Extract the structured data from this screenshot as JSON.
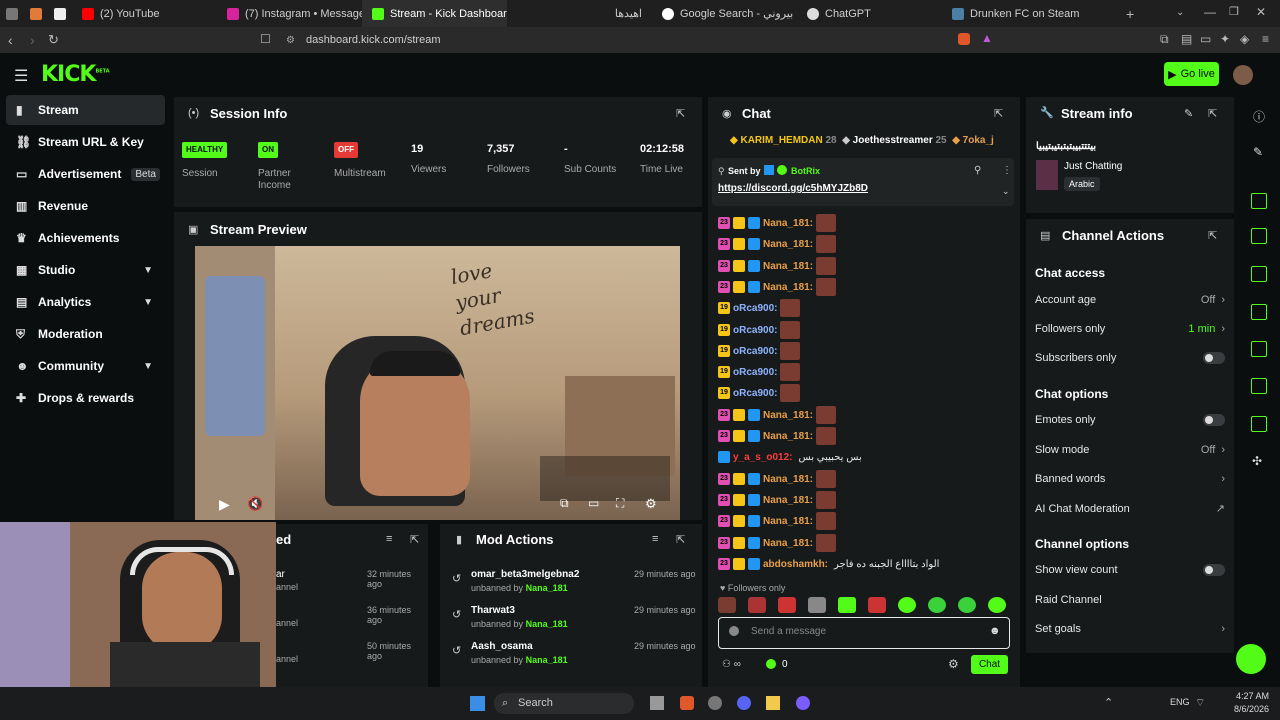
{
  "browser": {
    "tabs": [
      {
        "label": "",
        "color": "#888"
      },
      {
        "label": "",
        "color": "#e07b39"
      },
      {
        "label": "",
        "color": "#eee"
      },
      {
        "label": "(2) YouTube",
        "color": "#ff0000"
      },
      {
        "label": "(7) Instagram • Messages",
        "color": "#d6249f"
      },
      {
        "label": "Stream - Kick Dashboard",
        "color": "#53fc18"
      },
      {
        "label": "اهيدها",
        "color": "#888"
      },
      {
        "label": "Google Search - بيتزا بيروني",
        "color": "#4285f4"
      },
      {
        "label": "ChatGPT",
        "color": "#ddd"
      },
      {
        "label": "Drunken FC on Steam",
        "color": "#2a475e"
      }
    ],
    "url": "dashboard.kick.com/stream"
  },
  "header": {
    "logo": "KICK",
    "logo_sup": "BETA",
    "go_live": "Go live"
  },
  "sidebar": {
    "items": [
      {
        "label": "Stream",
        "icon": "broadcast-icon"
      },
      {
        "label": "Stream URL & Key",
        "icon": "link-icon"
      },
      {
        "label": "Advertisement",
        "icon": "ad-icon",
        "badge": "Beta"
      },
      {
        "label": "Revenue",
        "icon": "revenue-icon"
      },
      {
        "label": "Achievements",
        "icon": "trophy-icon"
      },
      {
        "label": "Studio",
        "icon": "studio-icon",
        "chevron": true
      },
      {
        "label": "Analytics",
        "icon": "analytics-icon",
        "chevron": true
      },
      {
        "label": "Moderation",
        "icon": "shield-icon"
      },
      {
        "label": "Community",
        "icon": "people-icon",
        "chevron": true
      },
      {
        "label": "Drops & rewards",
        "icon": "gift-icon"
      }
    ]
  },
  "session": {
    "title": "Session Info",
    "stats": [
      {
        "badge": "HEALTHY",
        "label": "Session",
        "badge_bg": "#53fc18",
        "badge_fg": "#0b0e0f"
      },
      {
        "badge": "ON",
        "label": "Partner Income",
        "badge_bg": "#53fc18",
        "badge_fg": "#0b0e0f"
      },
      {
        "badge": "OFF",
        "label": "Multistream",
        "badge_bg": "#e53935",
        "badge_fg": "#ffffff"
      },
      {
        "value": "19",
        "label": "Viewers"
      },
      {
        "value": "7,357",
        "label": "Followers"
      },
      {
        "value": "-",
        "label": "Sub Counts"
      },
      {
        "value": "02:12:58",
        "label": "Time Live"
      }
    ]
  },
  "preview": {
    "title": "Stream Preview",
    "wall_text": "love your dreams"
  },
  "partial_panel": {
    "title_fragment": "ed",
    "rows": [
      {
        "name": "ar",
        "sub": "annel",
        "time": "32 minutes ago"
      },
      {
        "name": "",
        "sub": "annel",
        "time": "36 minutes ago"
      },
      {
        "name": "",
        "sub": "annel",
        "time": "50 minutes ago"
      }
    ]
  },
  "mod_actions": {
    "title": "Mod Actions",
    "rows": [
      {
        "user": "omar_beta3melgebna2",
        "action": "unbanned by",
        "by": "Nana_181",
        "time": "29 minutes ago"
      },
      {
        "user": "Tharwat3",
        "action": "unbanned by",
        "by": "Nana_181",
        "time": "29 minutes ago"
      },
      {
        "user": "Aash_osama",
        "action": "unbanned by",
        "by": "Nana_181",
        "time": "29 minutes ago"
      }
    ]
  },
  "chat": {
    "title": "Chat",
    "top_gifters": [
      {
        "name": "KARIM_HEMDAN",
        "count": "28"
      },
      {
        "name": "Joethesstreamer",
        "count": "25"
      },
      {
        "name": "7oka_j",
        "count": ""
      }
    ],
    "pinned": {
      "sent_by_label": "Sent by",
      "sender": "BotRix",
      "link": "https://discord.gg/c5hMYJZb8D"
    },
    "messages": [
      {
        "badge_num": "23",
        "badge_color": "#e24fb2",
        "user": "Nana_181:",
        "color": "#e8a04a"
      },
      {
        "badge_num": "23",
        "badge_color": "#e24fb2",
        "user": "Nana_181:",
        "color": "#e8a04a"
      },
      {
        "badge_num": "23",
        "badge_color": "#e24fb2",
        "user": "Nana_181:",
        "color": "#e8a04a"
      },
      {
        "badge_num": "23",
        "badge_color": "#e24fb2",
        "user": "Nana_181:",
        "color": "#e8a04a"
      },
      {
        "badge_num": "19",
        "badge_color": "#f5c518",
        "user": "oRca900:",
        "color": "#8fb3ff"
      },
      {
        "badge_num": "19",
        "badge_color": "#f5c518",
        "user": "oRca900:",
        "color": "#8fb3ff"
      },
      {
        "badge_num": "19",
        "badge_color": "#f5c518",
        "user": "oRca900:",
        "color": "#8fb3ff"
      },
      {
        "badge_num": "19",
        "badge_color": "#f5c518",
        "user": "oRca900:",
        "color": "#8fb3ff"
      },
      {
        "badge_num": "19",
        "badge_color": "#f5c518",
        "user": "oRca900:",
        "color": "#8fb3ff"
      },
      {
        "badge_num": "23",
        "badge_color": "#e24fb2",
        "user": "Nana_181:",
        "color": "#e8a04a"
      },
      {
        "badge_num": "23",
        "badge_color": "#e24fb2",
        "user": "Nana_181:",
        "color": "#e8a04a"
      },
      {
        "badge_num": "",
        "badge_color": "#2196f3",
        "user": "y_a_s_o012:",
        "color": "#ff3b3b",
        "text": "بس يحبيبي بس"
      },
      {
        "badge_num": "23",
        "badge_color": "#e24fb2",
        "user": "Nana_181:",
        "color": "#e8a04a"
      },
      {
        "badge_num": "23",
        "badge_color": "#e24fb2",
        "user": "Nana_181:",
        "color": "#e8a04a"
      },
      {
        "badge_num": "23",
        "badge_color": "#e24fb2",
        "user": "Nana_181:",
        "color": "#e8a04a"
      },
      {
        "badge_num": "23",
        "badge_color": "#e24fb2",
        "user": "Nana_181:",
        "color": "#e8a04a"
      },
      {
        "badge_num": "23",
        "badge_color": "#e24fb2",
        "user": "abdoshamkh:",
        "color": "#e8a04a",
        "text": "الواد بتااااع الجبنه ده فاجر"
      }
    ],
    "followers_only": "Followers only",
    "placeholder": "Send a message",
    "points": "0",
    "send": "Chat"
  },
  "stream_info": {
    "title": "Stream info",
    "stream_title": "بيتتتبيبتبتبتيبتيبيا",
    "category": "Just Chatting",
    "language": "Arabic"
  },
  "channel_actions": {
    "title": "Channel Actions",
    "chat_access": "Chat access",
    "account_age": "Account age",
    "account_age_val": "Off",
    "followers_only": "Followers only",
    "followers_only_val": "1 min",
    "subscribers_only": "Subscribers only",
    "chat_options": "Chat options",
    "emotes_only": "Emotes only",
    "slow_mode": "Slow mode",
    "slow_mode_val": "Off",
    "banned_words": "Banned words",
    "ai_mod": "AI Chat Moderation",
    "channel_options": "Channel options",
    "show_view_count": "Show view count",
    "raid_channel": "Raid Channel",
    "set_goals": "Set goals"
  },
  "taskbar": {
    "search": "Search",
    "lang": "ENG",
    "time": "4:27 AM",
    "date": "8/6/2026"
  },
  "colors": {
    "brand": "#53fc18",
    "panel": "#171a1b",
    "background": "#0b0e0f"
  }
}
